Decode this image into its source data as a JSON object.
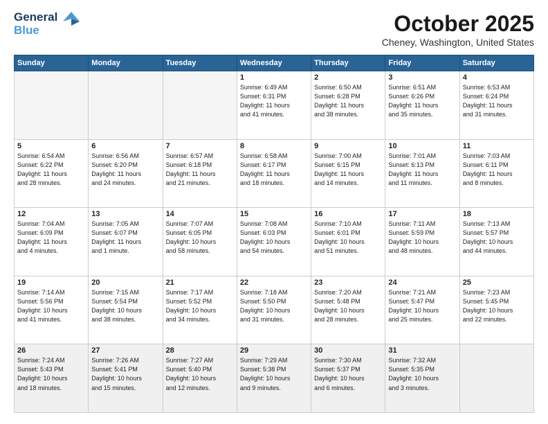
{
  "logo": {
    "general": "General",
    "blue": "Blue",
    "tagline": ""
  },
  "header": {
    "month": "October 2025",
    "location": "Cheney, Washington, United States"
  },
  "days_of_week": [
    "Sunday",
    "Monday",
    "Tuesday",
    "Wednesday",
    "Thursday",
    "Friday",
    "Saturday"
  ],
  "weeks": [
    [
      {
        "day": "",
        "content": ""
      },
      {
        "day": "",
        "content": ""
      },
      {
        "day": "",
        "content": ""
      },
      {
        "day": "1",
        "content": "Sunrise: 6:49 AM\nSunset: 6:31 PM\nDaylight: 11 hours\nand 41 minutes."
      },
      {
        "day": "2",
        "content": "Sunrise: 6:50 AM\nSunset: 6:28 PM\nDaylight: 11 hours\nand 38 minutes."
      },
      {
        "day": "3",
        "content": "Sunrise: 6:51 AM\nSunset: 6:26 PM\nDaylight: 11 hours\nand 35 minutes."
      },
      {
        "day": "4",
        "content": "Sunrise: 6:53 AM\nSunset: 6:24 PM\nDaylight: 11 hours\nand 31 minutes."
      }
    ],
    [
      {
        "day": "5",
        "content": "Sunrise: 6:54 AM\nSunset: 6:22 PM\nDaylight: 11 hours\nand 28 minutes."
      },
      {
        "day": "6",
        "content": "Sunrise: 6:56 AM\nSunset: 6:20 PM\nDaylight: 11 hours\nand 24 minutes."
      },
      {
        "day": "7",
        "content": "Sunrise: 6:57 AM\nSunset: 6:18 PM\nDaylight: 11 hours\nand 21 minutes."
      },
      {
        "day": "8",
        "content": "Sunrise: 6:58 AM\nSunset: 6:17 PM\nDaylight: 11 hours\nand 18 minutes."
      },
      {
        "day": "9",
        "content": "Sunrise: 7:00 AM\nSunset: 6:15 PM\nDaylight: 11 hours\nand 14 minutes."
      },
      {
        "day": "10",
        "content": "Sunrise: 7:01 AM\nSunset: 6:13 PM\nDaylight: 11 hours\nand 11 minutes."
      },
      {
        "day": "11",
        "content": "Sunrise: 7:03 AM\nSunset: 6:11 PM\nDaylight: 11 hours\nand 8 minutes."
      }
    ],
    [
      {
        "day": "12",
        "content": "Sunrise: 7:04 AM\nSunset: 6:09 PM\nDaylight: 11 hours\nand 4 minutes."
      },
      {
        "day": "13",
        "content": "Sunrise: 7:05 AM\nSunset: 6:07 PM\nDaylight: 11 hours\nand 1 minute."
      },
      {
        "day": "14",
        "content": "Sunrise: 7:07 AM\nSunset: 6:05 PM\nDaylight: 10 hours\nand 58 minutes."
      },
      {
        "day": "15",
        "content": "Sunrise: 7:08 AM\nSunset: 6:03 PM\nDaylight: 10 hours\nand 54 minutes."
      },
      {
        "day": "16",
        "content": "Sunrise: 7:10 AM\nSunset: 6:01 PM\nDaylight: 10 hours\nand 51 minutes."
      },
      {
        "day": "17",
        "content": "Sunrise: 7:11 AM\nSunset: 5:59 PM\nDaylight: 10 hours\nand 48 minutes."
      },
      {
        "day": "18",
        "content": "Sunrise: 7:13 AM\nSunset: 5:57 PM\nDaylight: 10 hours\nand 44 minutes."
      }
    ],
    [
      {
        "day": "19",
        "content": "Sunrise: 7:14 AM\nSunset: 5:56 PM\nDaylight: 10 hours\nand 41 minutes."
      },
      {
        "day": "20",
        "content": "Sunrise: 7:15 AM\nSunset: 5:54 PM\nDaylight: 10 hours\nand 38 minutes."
      },
      {
        "day": "21",
        "content": "Sunrise: 7:17 AM\nSunset: 5:52 PM\nDaylight: 10 hours\nand 34 minutes."
      },
      {
        "day": "22",
        "content": "Sunrise: 7:18 AM\nSunset: 5:50 PM\nDaylight: 10 hours\nand 31 minutes."
      },
      {
        "day": "23",
        "content": "Sunrise: 7:20 AM\nSunset: 5:48 PM\nDaylight: 10 hours\nand 28 minutes."
      },
      {
        "day": "24",
        "content": "Sunrise: 7:21 AM\nSunset: 5:47 PM\nDaylight: 10 hours\nand 25 minutes."
      },
      {
        "day": "25",
        "content": "Sunrise: 7:23 AM\nSunset: 5:45 PM\nDaylight: 10 hours\nand 22 minutes."
      }
    ],
    [
      {
        "day": "26",
        "content": "Sunrise: 7:24 AM\nSunset: 5:43 PM\nDaylight: 10 hours\nand 18 minutes."
      },
      {
        "day": "27",
        "content": "Sunrise: 7:26 AM\nSunset: 5:41 PM\nDaylight: 10 hours\nand 15 minutes."
      },
      {
        "day": "28",
        "content": "Sunrise: 7:27 AM\nSunset: 5:40 PM\nDaylight: 10 hours\nand 12 minutes."
      },
      {
        "day": "29",
        "content": "Sunrise: 7:29 AM\nSunset: 5:38 PM\nDaylight: 10 hours\nand 9 minutes."
      },
      {
        "day": "30",
        "content": "Sunrise: 7:30 AM\nSunset: 5:37 PM\nDaylight: 10 hours\nand 6 minutes."
      },
      {
        "day": "31",
        "content": "Sunrise: 7:32 AM\nSunset: 5:35 PM\nDaylight: 10 hours\nand 3 minutes."
      },
      {
        "day": "",
        "content": ""
      }
    ]
  ]
}
